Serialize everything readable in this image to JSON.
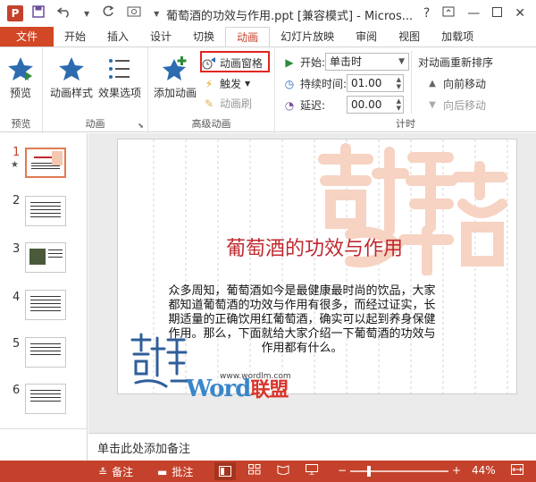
{
  "titlebar": {
    "app_letter": "P",
    "title": "葡萄酒的功效与作用.ppt [兼容模式] - Micros...",
    "help": "?"
  },
  "tabs": [
    "文件",
    "开始",
    "插入",
    "设计",
    "切换",
    "动画",
    "幻灯片放映",
    "审阅",
    "视图",
    "加载项"
  ],
  "ribbon": {
    "preview": {
      "label": "预览",
      "group": "预览"
    },
    "animation": {
      "styles": "动画样式",
      "effects": "效果选项",
      "group": "动画"
    },
    "advanced": {
      "add": "添加动画",
      "pane": "动画窗格",
      "trigger": "触发",
      "painter": "动画刷",
      "group": "高级动画"
    },
    "timing": {
      "start_label": "开始:",
      "start_value": "单击时",
      "duration_label": "持续时间:",
      "duration_value": "01.00",
      "delay_label": "延迟:",
      "delay_value": "00.00",
      "reorder_title": "对动画重新排序",
      "move_earlier": "向前移动",
      "move_later": "向后移动",
      "group": "计时"
    }
  },
  "thumbnails": [
    "1",
    "2",
    "3",
    "4",
    "5",
    "6"
  ],
  "slide": {
    "tags": [
      "1",
      "2"
    ],
    "title": "葡萄酒的功效与作用",
    "body": "众多周知，葡萄酒如今是最健康最时尚的饮品，大家都知道葡萄酒的功效与作用有很多，而经过证实，长期适量的正确饮用红葡萄酒，确实可以起到养身保健作用。那么，下面就给大家介绍一下葡萄酒的功效与作用都有什么。"
  },
  "watermark": {
    "url": "www.wordlm.com",
    "brand_en": "Word",
    "brand_cn": "联盟"
  },
  "notes_placeholder": "单击此处添加备注",
  "status": {
    "notes": "备注",
    "comments": "批注",
    "zoom": "44%",
    "zoom_level": 0.44
  },
  "colors": {
    "accent": "#c4422b",
    "highlight": "#e0261e"
  }
}
